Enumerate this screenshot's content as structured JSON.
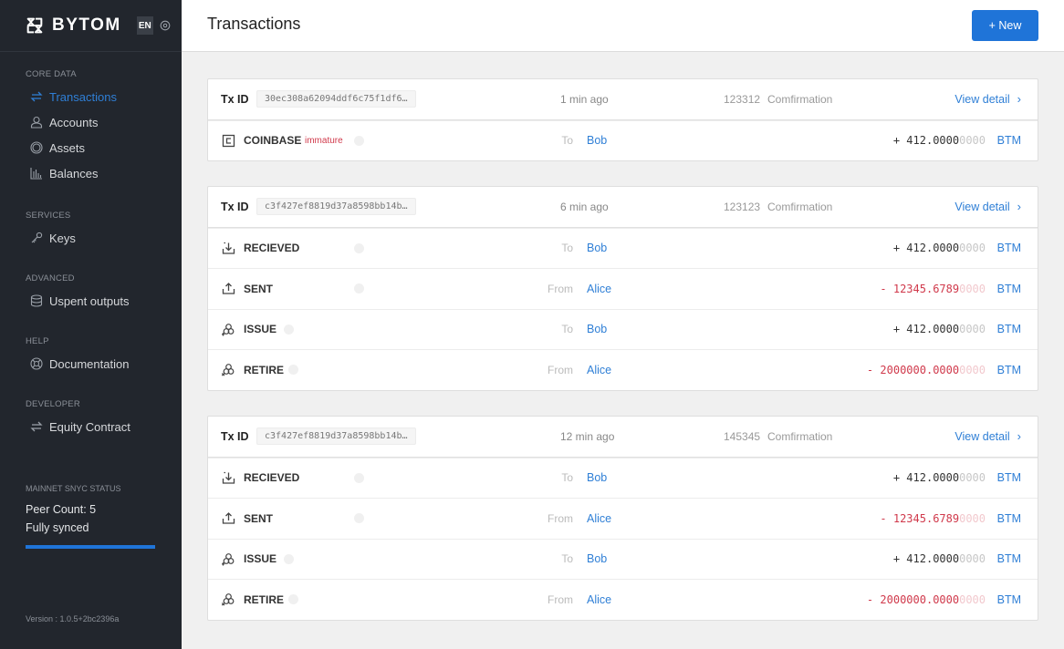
{
  "brand": {
    "name": "BYTOM",
    "lang": "EN"
  },
  "sidebar": {
    "sections": [
      {
        "title": "CORE DATA",
        "items": [
          {
            "label": "Transactions",
            "icon": "transfer-icon",
            "active": true
          },
          {
            "label": "Accounts",
            "icon": "user-icon"
          },
          {
            "label": "Assets",
            "icon": "asset-circle-icon"
          },
          {
            "label": "Balances",
            "icon": "bar-chart-icon"
          }
        ]
      },
      {
        "title": "SERVICES",
        "items": [
          {
            "label": "Keys",
            "icon": "key-icon"
          }
        ]
      },
      {
        "title": "ADVANCED",
        "items": [
          {
            "label": "Uspent outputs",
            "icon": "database-icon"
          }
        ]
      },
      {
        "title": "HELP",
        "items": [
          {
            "label": "Documentation",
            "icon": "lifebuoy-icon"
          }
        ]
      },
      {
        "title": "DEVELOPER",
        "items": [
          {
            "label": "Equity Contract",
            "icon": "transfer-icon"
          }
        ]
      }
    ],
    "sync": {
      "title": "MAINNET SNYC STATUS",
      "peer_count": "Peer Count: 5",
      "state": "Fully synced",
      "progress_percent": 100
    },
    "version": "Version :  1.0.5+2bc2396a"
  },
  "header": {
    "title": "Transactions",
    "new_button": "+ New"
  },
  "labels": {
    "tx_id": "Tx ID",
    "confirmation": "Comfirmation",
    "view_detail": "View detail",
    "chevron": "›"
  },
  "colors": {
    "accent": "#1f74d8",
    "negative": "#d0394b",
    "sidebar_bg": "#22262d"
  },
  "transactions": [
    {
      "id": "30ec308a62094ddf6c75f1df6…",
      "time": "1 min ago",
      "confirmations": "123312",
      "rows": [
        {
          "type": "COINBASE",
          "icon": "coinbase-icon",
          "tag": "immature",
          "dir": "To",
          "party": "Bob",
          "sign": "+",
          "amount_main": "412.0000",
          "amount_faded": "0000",
          "unit": "BTM"
        }
      ]
    },
    {
      "id": "c3f427ef8819d37a8598bb14b…",
      "time": "6 min ago",
      "confirmations": "123123",
      "rows": [
        {
          "type": "RECIEVED",
          "icon": "download-tray-icon",
          "dir": "To",
          "party": "Bob",
          "sign": "+",
          "amount_main": "412.0000",
          "amount_faded": "0000",
          "unit": "BTM"
        },
        {
          "type": "SENT",
          "icon": "upload-tray-icon",
          "dir": "From",
          "party": "Alice",
          "sign": "-",
          "amount_main": "12345.6789",
          "amount_faded": "0000",
          "unit": "BTM"
        },
        {
          "type": "ISSUE",
          "icon": "issue-asset-icon",
          "dir": "To",
          "party": "Bob",
          "sign": "+",
          "amount_main": "412.0000",
          "amount_faded": "0000",
          "unit": "BTM"
        },
        {
          "type": "RETIRE",
          "icon": "retire-asset-icon",
          "dir": "From",
          "party": "Alice",
          "sign": "-",
          "amount_main": "2000000.0000",
          "amount_faded": "0000",
          "unit": "BTM"
        }
      ]
    },
    {
      "id": "c3f427ef8819d37a8598bb14b…",
      "time": "12 min ago",
      "confirmations": "145345",
      "rows": [
        {
          "type": "RECIEVED",
          "icon": "download-tray-icon",
          "dir": "To",
          "party": "Bob",
          "sign": "+",
          "amount_main": "412.0000",
          "amount_faded": "0000",
          "unit": "BTM"
        },
        {
          "type": "SENT",
          "icon": "upload-tray-icon",
          "dir": "From",
          "party": "Alice",
          "sign": "-",
          "amount_main": "12345.6789",
          "amount_faded": "0000",
          "unit": "BTM"
        },
        {
          "type": "ISSUE",
          "icon": "issue-asset-icon",
          "dir": "To",
          "party": "Bob",
          "sign": "+",
          "amount_main": "412.0000",
          "amount_faded": "0000",
          "unit": "BTM"
        },
        {
          "type": "RETIRE",
          "icon": "retire-asset-icon",
          "dir": "From",
          "party": "Alice",
          "sign": "-",
          "amount_main": "2000000.0000",
          "amount_faded": "0000",
          "unit": "BTM"
        }
      ]
    }
  ]
}
